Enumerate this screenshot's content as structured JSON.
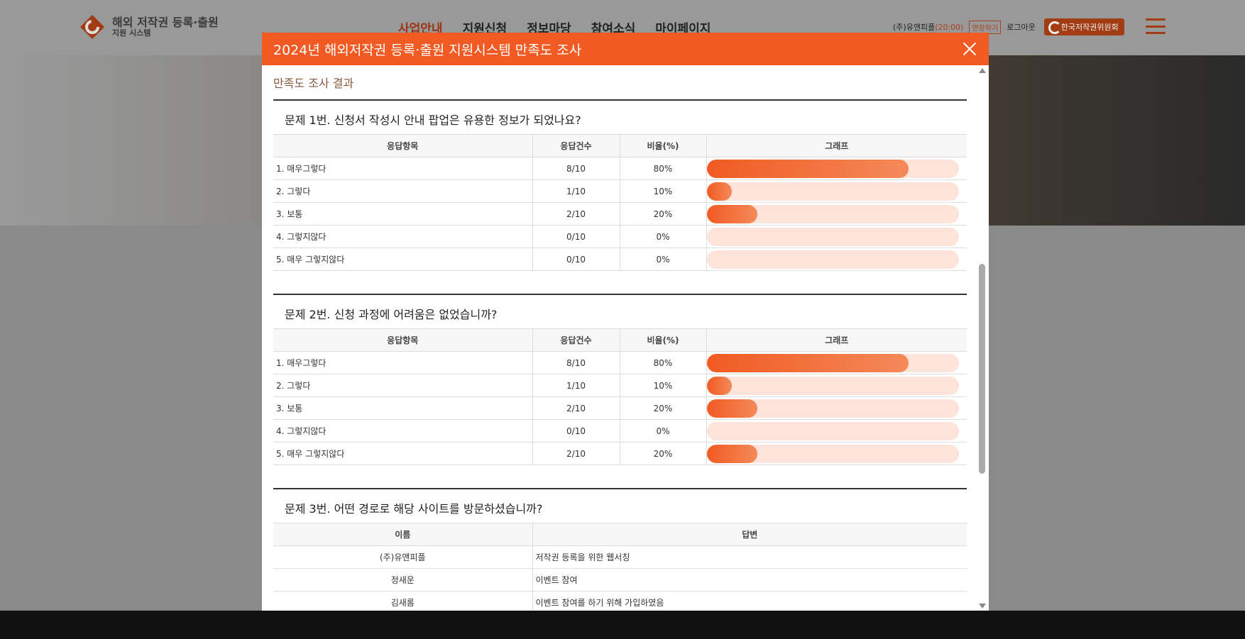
{
  "site": {
    "logo_title": "해외 저작권 등록·출원",
    "logo_sub": "지원 시스템",
    "nav": [
      "사업안내",
      "지원신청",
      "정보마당",
      "참여소식",
      "마이페이지"
    ],
    "user": "(주)유앤피플",
    "time": "(20:00)",
    "extend_label": "연장하기",
    "logout_label": "로그아웃",
    "committee_label": "한국저작권위원회"
  },
  "modal": {
    "title": "2024년 해외저작권 등록·출원 지원시스템 만족도 조사",
    "section_title": "만족도 조사 결과"
  },
  "table_headers": {
    "item": "응답항목",
    "count": "응답건수",
    "ratio": "비율(%)",
    "graph": "그래프"
  },
  "questions": [
    {
      "title": "문제 1번. 신청서 작성시 안내 팝업은 유용한 정보가 되었나요?",
      "rows": [
        {
          "item": "1. 매우그렇다",
          "count": "8/10",
          "ratio": "80%",
          "fraction": 0.8
        },
        {
          "item": "2. 그렇다",
          "count": "1/10",
          "ratio": "10%",
          "fraction": 0.1
        },
        {
          "item": "3. 보통",
          "count": "2/10",
          "ratio": "20%",
          "fraction": 0.2
        },
        {
          "item": "4. 그렇지않다",
          "count": "0/10",
          "ratio": "0%",
          "fraction": 0
        },
        {
          "item": "5. 매우 그렇지않다",
          "count": "0/10",
          "ratio": "0%",
          "fraction": 0
        }
      ]
    },
    {
      "title": "문제 2번. 신청 과정에 어려움은 없었습니까?",
      "rows": [
        {
          "item": "1. 매우그렇다",
          "count": "8/10",
          "ratio": "80%",
          "fraction": 0.8
        },
        {
          "item": "2. 그렇다",
          "count": "1/10",
          "ratio": "10%",
          "fraction": 0.1
        },
        {
          "item": "3. 보통",
          "count": "2/10",
          "ratio": "20%",
          "fraction": 0.2
        },
        {
          "item": "4. 그렇지않다",
          "count": "0/10",
          "ratio": "0%",
          "fraction": 0
        },
        {
          "item": "5. 매우 그렇지않다",
          "count": "2/10",
          "ratio": "20%",
          "fraction": 0.2
        }
      ]
    }
  ],
  "question3": {
    "title": "문제 3번. 어떤 경로로 해당 사이트를 방문하셨습니까?",
    "headers": {
      "name": "이름",
      "answer": "답변"
    },
    "rows": [
      {
        "name": "(주)유앤피플",
        "answer": "저작권 등록을 위한 웹서칭"
      },
      {
        "name": "정새운",
        "answer": "이벤트 참여"
      },
      {
        "name": "김새롬",
        "answer": "이벤트 참여를 하기 위해 가입하였음"
      }
    ]
  },
  "colors": {
    "accent": "#f15a22",
    "bar_track": "#fde3da"
  }
}
